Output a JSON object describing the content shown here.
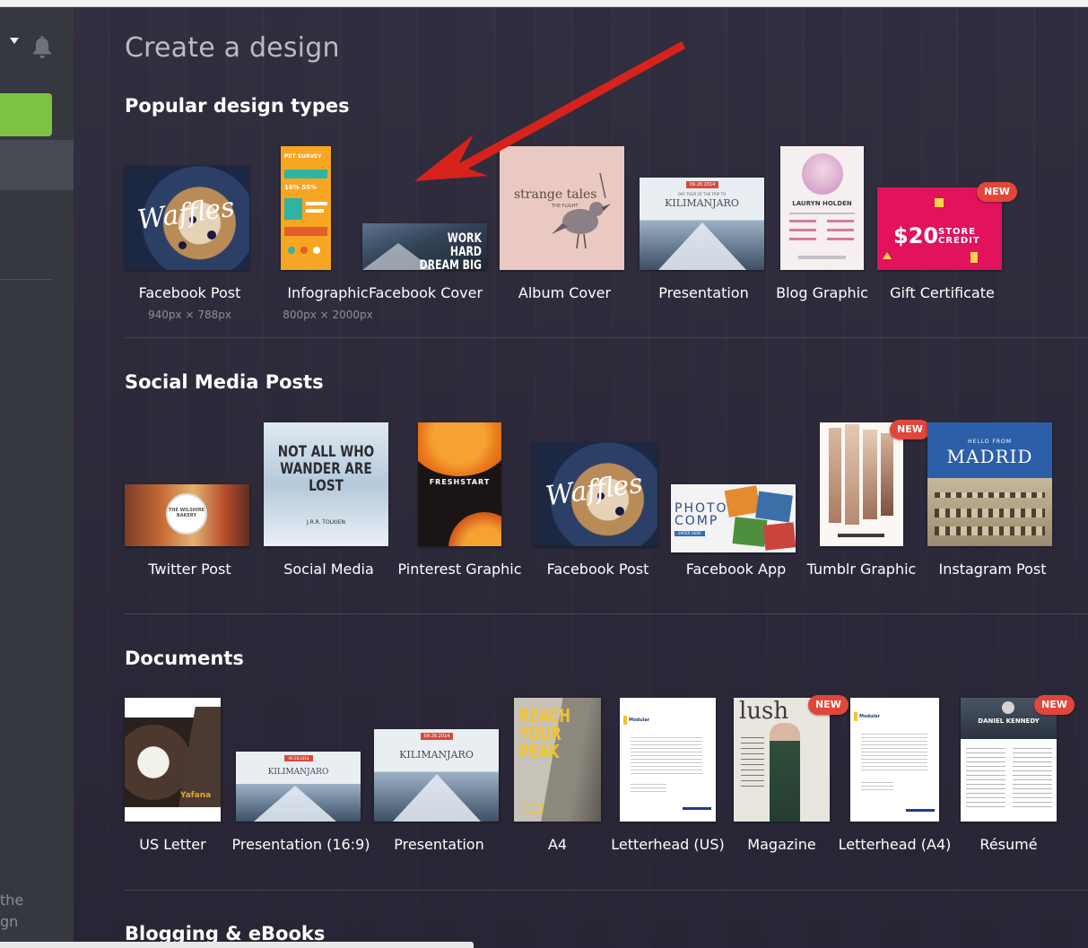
{
  "page": {
    "title": "Create a design"
  },
  "sidebar": {
    "cut_text_1": "the",
    "cut_text_2": "gn"
  },
  "sections": [
    {
      "title": "Popular design types",
      "items": [
        {
          "label": "Facebook Post",
          "size": "940px × 788px",
          "thumb_text": "Waffles",
          "thumb_title": ""
        },
        {
          "label": "Infographic",
          "size": "800px × 2000px",
          "thumb_title": "PET SURVEY",
          "thumb_text": "16% 55%"
        },
        {
          "label": "Facebook Cover",
          "thumb_text": "WORK HARD DREAM BIG"
        },
        {
          "label": "Album Cover",
          "thumb_text": "strange tales",
          "thumb_sub": "THE FLIGHT"
        },
        {
          "label": "Presentation",
          "thumb_date": "09.28.2014",
          "thumb_text": "KILIMANJARO",
          "thumb_sub": "DAY TOUR OF THE TRIP TO"
        },
        {
          "label": "Blog Graphic",
          "thumb_text": "LAURYN HOLDEN"
        },
        {
          "label": "Gift Certificate",
          "badge": "NEW",
          "thumb_amount": "$20",
          "thumb_text": "STORE CREDIT"
        }
      ]
    },
    {
      "title": "Social Media Posts",
      "items": [
        {
          "label": "Twitter Post",
          "thumb_text": "THE WILSHIRE BAKERY"
        },
        {
          "label": "Social Media",
          "thumb_text": "NOT ALL WHO WANDER ARE LOST",
          "thumb_sub": "J.R.R. TOLKIEN"
        },
        {
          "label": "Pinterest Graphic",
          "thumb_text": "FRESHSTART"
        },
        {
          "label": "Facebook Post",
          "thumb_text": "Waffles"
        },
        {
          "label": "Facebook App",
          "thumb_text": "PHOTO COMP",
          "thumb_sub": "ENTER HERE"
        },
        {
          "label": "Tumblr Graphic",
          "badge": "NEW",
          "thumb_text": ""
        },
        {
          "label": "Instagram Post",
          "thumb_sub": "HELLO FROM",
          "thumb_text": "MADRID"
        }
      ]
    },
    {
      "title": "Documents",
      "items": [
        {
          "label": "US Letter",
          "thumb_text": "Yafana"
        },
        {
          "label": "Presentation (16:9)",
          "thumb_date": "09.28.2014",
          "thumb_text": "KILIMANJARO"
        },
        {
          "label": "Presentation",
          "thumb_date": "09.28.2014",
          "thumb_text": "KILIMANJARO"
        },
        {
          "label": "A4",
          "thumb_text": "REACH YOUR PEAK"
        },
        {
          "label": "Letterhead (US)",
          "thumb_text": "Modular"
        },
        {
          "label": "Magazine",
          "badge": "NEW",
          "thumb_text": "lush"
        },
        {
          "label": "Letterhead (A4)",
          "thumb_text": "Modular"
        },
        {
          "label": "Résumé",
          "badge": "NEW",
          "thumb_text": "DANIEL KENNEDY"
        }
      ]
    },
    {
      "title": "Blogging & eBooks",
      "items": []
    }
  ],
  "colors": {
    "background": "#2a2738",
    "sidebar": "#363840",
    "accent_green": "#7dc242",
    "badge_red": "#e2463b",
    "arrow_red": "#d7221c"
  }
}
